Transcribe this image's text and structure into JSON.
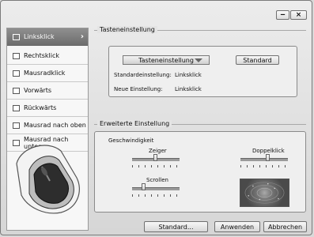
{
  "window": {
    "minimize_icon": "minimize-icon",
    "close_icon": "close-icon",
    "minimize_glyph": "‒",
    "close_glyph": "×"
  },
  "sidebar": {
    "items": [
      {
        "label": "Linksklick",
        "active": true
      },
      {
        "label": "Rechtsklick"
      },
      {
        "label": "Mausradklick"
      },
      {
        "label": "Vorwärts"
      },
      {
        "label": "Rückwärts"
      },
      {
        "label": "Mausrad nach oben"
      },
      {
        "label": "Mausrad nach unten"
      }
    ],
    "chevron": "›"
  },
  "key_setting": {
    "group_title": "Tasteneinstellung",
    "dropdown_value": "Tasteneinstellung",
    "default_button": "Standard",
    "default_label": "Standardeinstellung:",
    "default_value": "Linksklick",
    "new_label": "Neue Einstellung:",
    "new_value": "Linksklick"
  },
  "advanced": {
    "group_title": "Erweiterte Einstellung",
    "speed_label": "Geschwindigkeit",
    "pointer_label": "Zeiger",
    "doubleclick_label": "Doppelklick",
    "scroll_label": "Scrollen",
    "pointer_level": 0.5,
    "doubleclick_level": 0.5,
    "scroll_level": 0.25
  },
  "footer": {
    "default_button": "Standard...",
    "apply_button": "Anwenden",
    "cancel_button": "Abbrechen"
  }
}
